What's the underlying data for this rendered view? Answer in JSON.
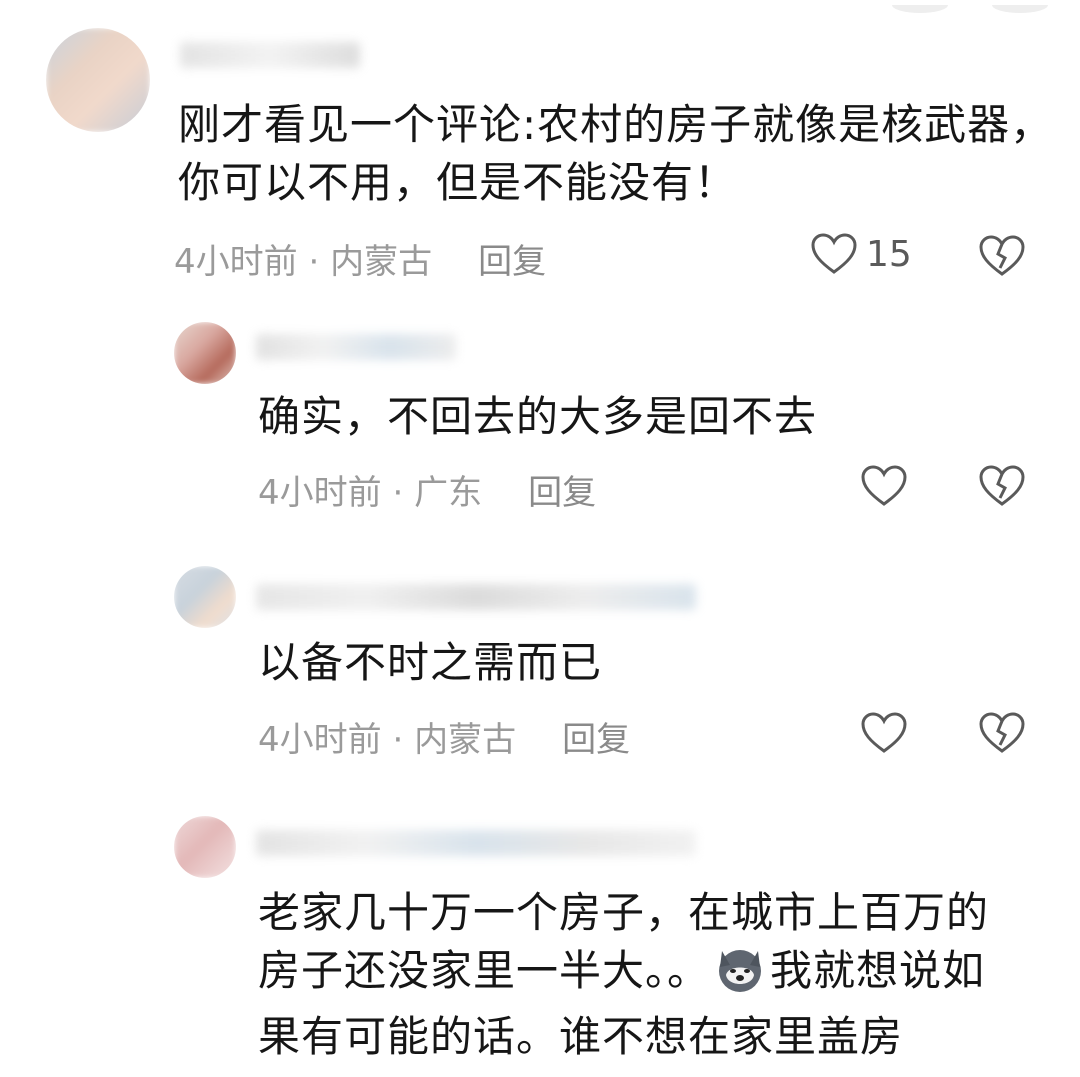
{
  "comments": [
    {
      "text_lines": [
        "刚才看见一个评论:农村的房子就像是核武器，",
        "你可以不用，但是不能没有！"
      ],
      "time": "4小时前",
      "location": "内蒙古",
      "reply_label": "回复",
      "likes": "15"
    },
    {
      "text_lines": [
        "确实，不回去的大多是回不去"
      ],
      "time": "4小时前",
      "location": "广东",
      "reply_label": "回复",
      "likes": ""
    },
    {
      "text_lines": [
        "以备不时之需而已"
      ],
      "time": "4小时前",
      "location": "内蒙古",
      "reply_label": "回复",
      "likes": ""
    },
    {
      "text_lines": [
        "老家几十万一个房子，在城市上百万的",
        "房子还没家里一半大。。",
        "我就想说如",
        "果有可能的话。谁不想在家里盖房"
      ],
      "time": "",
      "location": "",
      "reply_label": "",
      "likes": ""
    }
  ],
  "meta_separator": " · ",
  "colors": {
    "text": "#161616",
    "meta": "#9a9a9a",
    "icon": "#5a5a5a"
  },
  "icons": [
    "heart-outline-icon",
    "broken-heart-icon",
    "husky-emoji-icon"
  ]
}
